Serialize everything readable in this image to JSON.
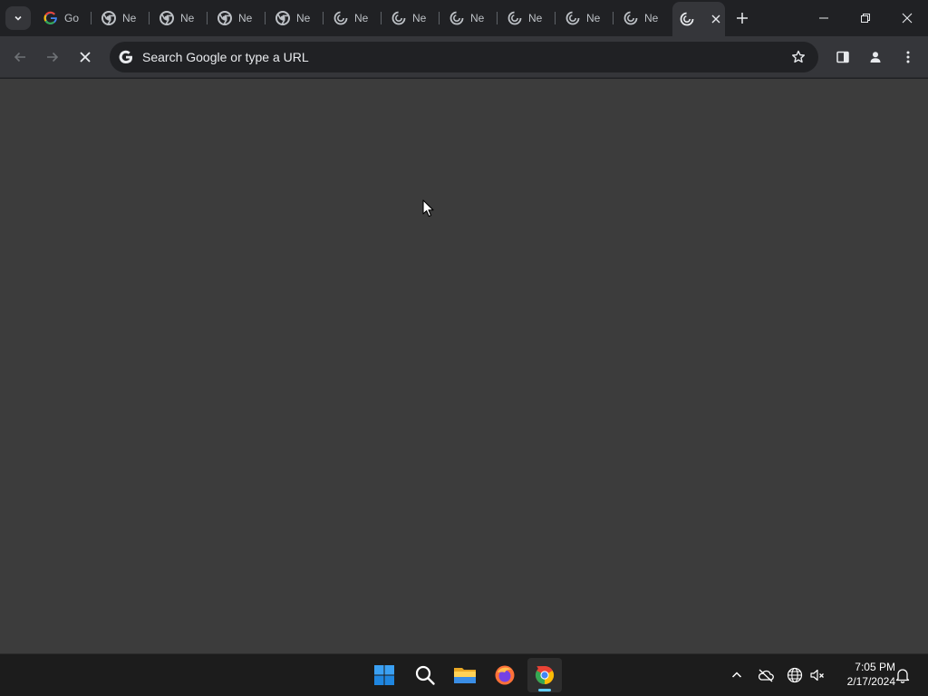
{
  "browser": {
    "tabs": [
      {
        "title": "Go",
        "favicon": "google-g-icon"
      },
      {
        "title": "Ne",
        "favicon": "chrome-icon"
      },
      {
        "title": "Ne",
        "favicon": "chrome-icon"
      },
      {
        "title": "Ne",
        "favicon": "chrome-icon"
      },
      {
        "title": "Ne",
        "favicon": "chrome-icon"
      },
      {
        "title": "Ne",
        "favicon": "loading-spinner-icon"
      },
      {
        "title": "Ne",
        "favicon": "loading-spinner-icon"
      },
      {
        "title": "Ne",
        "favicon": "loading-spinner-icon"
      },
      {
        "title": "Ne",
        "favicon": "loading-spinner-icon"
      },
      {
        "title": "Ne",
        "favicon": "loading-spinner-icon"
      },
      {
        "title": "Ne",
        "favicon": "loading-spinner-icon"
      }
    ],
    "active_tab": {
      "favicon": "loading-spinner-icon",
      "close_icon": "close-icon"
    },
    "omnibox": {
      "placeholder": "Search Google or type a URL",
      "value": ""
    },
    "colors": {
      "frame": "#202124",
      "toolbar": "#35363a",
      "content": "#3c3c3c",
      "omnibox": "#202124"
    }
  },
  "taskbar": {
    "apps": [
      {
        "name": "start",
        "icon": "windows-start-icon"
      },
      {
        "name": "search",
        "icon": "search-icon"
      },
      {
        "name": "file-explorer",
        "icon": "folder-icon"
      },
      {
        "name": "firefox",
        "icon": "firefox-icon"
      },
      {
        "name": "chrome",
        "icon": "chrome-icon",
        "active": true
      }
    ],
    "tray": [
      "chevron-up-icon",
      "onedrive-icon",
      "network-icon",
      "volume-muted-icon",
      "notification-bell-icon"
    ],
    "clock": {
      "time": "7:05 PM",
      "date": "2/17/2024"
    },
    "accent": "#60cdff"
  }
}
